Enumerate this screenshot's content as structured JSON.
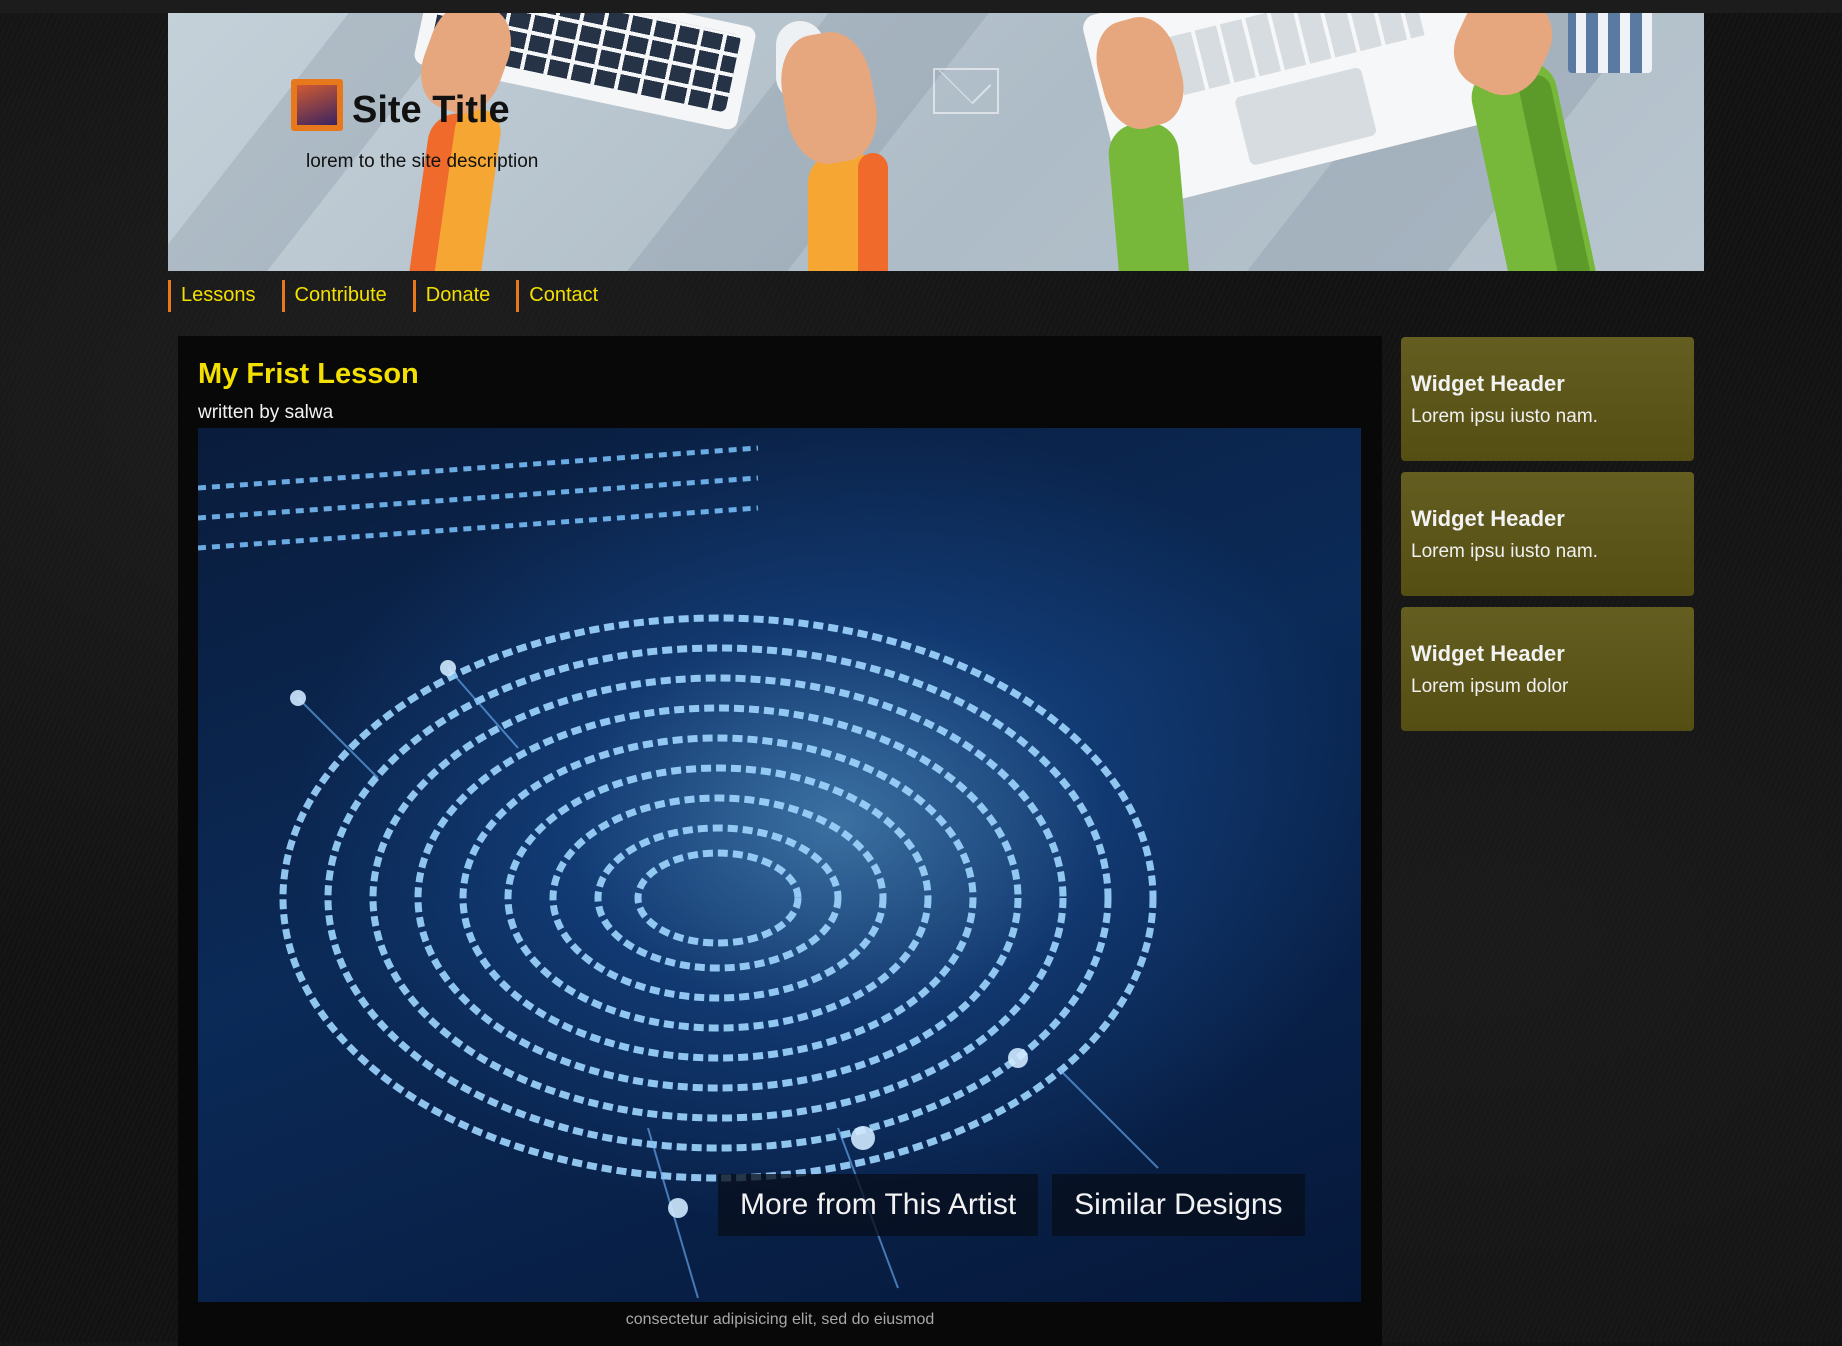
{
  "header": {
    "site_title": "Site Title",
    "site_description": "lorem to the site description"
  },
  "nav": {
    "items": [
      {
        "label": "Lessons"
      },
      {
        "label": "Contribute"
      },
      {
        "label": "Donate"
      },
      {
        "label": "Contact"
      }
    ]
  },
  "post": {
    "title": "My Frist Lesson",
    "byline": "written by salwa",
    "image_buttons": [
      "More from This Artist",
      "Similar Designs"
    ],
    "caption": "consectetur adipisicing elit, sed do eiusmod"
  },
  "sidebar": {
    "widgets": [
      {
        "header": "Widget Header",
        "text": "Lorem ipsu iusto nam."
      },
      {
        "header": "Widget Header",
        "text": "Lorem ipsu iusto nam."
      },
      {
        "header": "Widget Header",
        "text": "Lorem ipsum dolor"
      }
    ]
  },
  "colors": {
    "accent_yellow": "#f3e000",
    "nav_border_orange": "#e8781c",
    "widget_bg": "#5c5515",
    "page_bg": "#121212"
  }
}
